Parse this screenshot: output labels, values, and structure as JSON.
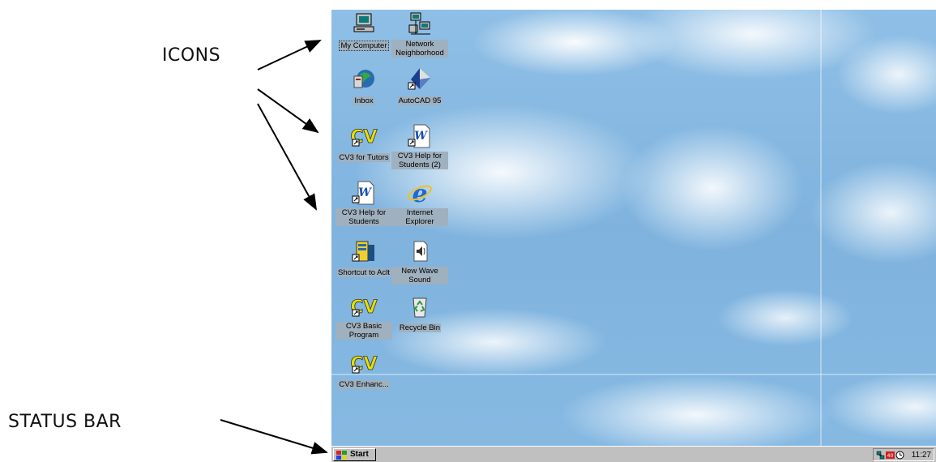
{
  "annotations": {
    "icons_label": "ICONS",
    "status_bar_label": "STATUS BAR"
  },
  "desktop": {
    "icons": [
      {
        "label": "My Computer",
        "icon": "computer-icon"
      },
      {
        "label": "Network Neighborhood",
        "icon": "network-icon"
      },
      {
        "label": "Inbox",
        "icon": "inbox-icon"
      },
      {
        "label": "AutoCAD 95",
        "icon": "autocad-icon"
      },
      {
        "label": "CV3 for Tutors",
        "icon": "cv-icon"
      },
      {
        "label": "CV3 Help for Students (2)",
        "icon": "word-doc-icon"
      },
      {
        "label": "CV3 Help for Students",
        "icon": "word-doc-icon"
      },
      {
        "label": "Internet Explorer",
        "icon": "internet-explorer-icon"
      },
      {
        "label": "Shortcut to Aclt",
        "icon": "aclt-icon"
      },
      {
        "label": "New Wave Sound",
        "icon": "sound-file-icon"
      },
      {
        "label": "CV3 Basic Program",
        "icon": "cv-icon"
      },
      {
        "label": "Recycle Bin",
        "icon": "recycle-bin-icon"
      },
      {
        "label": "CV3 Enhanc...",
        "icon": "cv-icon"
      }
    ]
  },
  "taskbar": {
    "start_label": "Start",
    "clock": "11:27",
    "tray_icons": [
      "network-tray-icon",
      "volume-tray-icon",
      "clock-tray-icon"
    ]
  },
  "colors": {
    "taskbar": "#c0c0c0",
    "sky": "#86b9e2",
    "icon_label_bg": "#9fb0bf"
  }
}
